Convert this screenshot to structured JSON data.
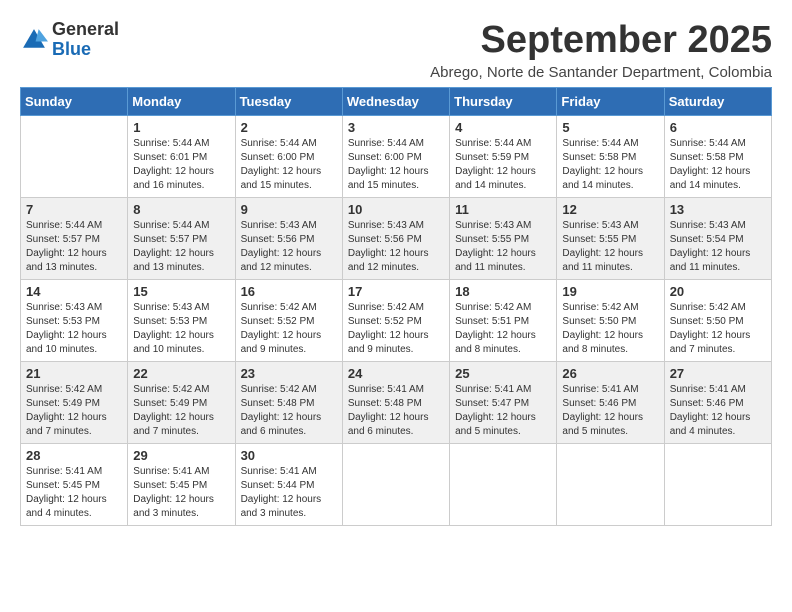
{
  "logo": {
    "general": "General",
    "blue": "Blue"
  },
  "title": "September 2025",
  "location": "Abrego, Norte de Santander Department, Colombia",
  "days": [
    "Sunday",
    "Monday",
    "Tuesday",
    "Wednesday",
    "Thursday",
    "Friday",
    "Saturday"
  ],
  "weeks": [
    [
      {
        "day": "",
        "info": ""
      },
      {
        "day": "1",
        "info": "Sunrise: 5:44 AM\nSunset: 6:01 PM\nDaylight: 12 hours\nand 16 minutes."
      },
      {
        "day": "2",
        "info": "Sunrise: 5:44 AM\nSunset: 6:00 PM\nDaylight: 12 hours\nand 15 minutes."
      },
      {
        "day": "3",
        "info": "Sunrise: 5:44 AM\nSunset: 6:00 PM\nDaylight: 12 hours\nand 15 minutes."
      },
      {
        "day": "4",
        "info": "Sunrise: 5:44 AM\nSunset: 5:59 PM\nDaylight: 12 hours\nand 14 minutes."
      },
      {
        "day": "5",
        "info": "Sunrise: 5:44 AM\nSunset: 5:58 PM\nDaylight: 12 hours\nand 14 minutes."
      },
      {
        "day": "6",
        "info": "Sunrise: 5:44 AM\nSunset: 5:58 PM\nDaylight: 12 hours\nand 14 minutes."
      }
    ],
    [
      {
        "day": "7",
        "info": "Sunrise: 5:44 AM\nSunset: 5:57 PM\nDaylight: 12 hours\nand 13 minutes."
      },
      {
        "day": "8",
        "info": "Sunrise: 5:44 AM\nSunset: 5:57 PM\nDaylight: 12 hours\nand 13 minutes."
      },
      {
        "day": "9",
        "info": "Sunrise: 5:43 AM\nSunset: 5:56 PM\nDaylight: 12 hours\nand 12 minutes."
      },
      {
        "day": "10",
        "info": "Sunrise: 5:43 AM\nSunset: 5:56 PM\nDaylight: 12 hours\nand 12 minutes."
      },
      {
        "day": "11",
        "info": "Sunrise: 5:43 AM\nSunset: 5:55 PM\nDaylight: 12 hours\nand 11 minutes."
      },
      {
        "day": "12",
        "info": "Sunrise: 5:43 AM\nSunset: 5:55 PM\nDaylight: 12 hours\nand 11 minutes."
      },
      {
        "day": "13",
        "info": "Sunrise: 5:43 AM\nSunset: 5:54 PM\nDaylight: 12 hours\nand 11 minutes."
      }
    ],
    [
      {
        "day": "14",
        "info": "Sunrise: 5:43 AM\nSunset: 5:53 PM\nDaylight: 12 hours\nand 10 minutes."
      },
      {
        "day": "15",
        "info": "Sunrise: 5:43 AM\nSunset: 5:53 PM\nDaylight: 12 hours\nand 10 minutes."
      },
      {
        "day": "16",
        "info": "Sunrise: 5:42 AM\nSunset: 5:52 PM\nDaylight: 12 hours\nand 9 minutes."
      },
      {
        "day": "17",
        "info": "Sunrise: 5:42 AM\nSunset: 5:52 PM\nDaylight: 12 hours\nand 9 minutes."
      },
      {
        "day": "18",
        "info": "Sunrise: 5:42 AM\nSunset: 5:51 PM\nDaylight: 12 hours\nand 8 minutes."
      },
      {
        "day": "19",
        "info": "Sunrise: 5:42 AM\nSunset: 5:50 PM\nDaylight: 12 hours\nand 8 minutes."
      },
      {
        "day": "20",
        "info": "Sunrise: 5:42 AM\nSunset: 5:50 PM\nDaylight: 12 hours\nand 7 minutes."
      }
    ],
    [
      {
        "day": "21",
        "info": "Sunrise: 5:42 AM\nSunset: 5:49 PM\nDaylight: 12 hours\nand 7 minutes."
      },
      {
        "day": "22",
        "info": "Sunrise: 5:42 AM\nSunset: 5:49 PM\nDaylight: 12 hours\nand 7 minutes."
      },
      {
        "day": "23",
        "info": "Sunrise: 5:42 AM\nSunset: 5:48 PM\nDaylight: 12 hours\nand 6 minutes."
      },
      {
        "day": "24",
        "info": "Sunrise: 5:41 AM\nSunset: 5:48 PM\nDaylight: 12 hours\nand 6 minutes."
      },
      {
        "day": "25",
        "info": "Sunrise: 5:41 AM\nSunset: 5:47 PM\nDaylight: 12 hours\nand 5 minutes."
      },
      {
        "day": "26",
        "info": "Sunrise: 5:41 AM\nSunset: 5:46 PM\nDaylight: 12 hours\nand 5 minutes."
      },
      {
        "day": "27",
        "info": "Sunrise: 5:41 AM\nSunset: 5:46 PM\nDaylight: 12 hours\nand 4 minutes."
      }
    ],
    [
      {
        "day": "28",
        "info": "Sunrise: 5:41 AM\nSunset: 5:45 PM\nDaylight: 12 hours\nand 4 minutes."
      },
      {
        "day": "29",
        "info": "Sunrise: 5:41 AM\nSunset: 5:45 PM\nDaylight: 12 hours\nand 3 minutes."
      },
      {
        "day": "30",
        "info": "Sunrise: 5:41 AM\nSunset: 5:44 PM\nDaylight: 12 hours\nand 3 minutes."
      },
      {
        "day": "",
        "info": ""
      },
      {
        "day": "",
        "info": ""
      },
      {
        "day": "",
        "info": ""
      },
      {
        "day": "",
        "info": ""
      }
    ]
  ]
}
